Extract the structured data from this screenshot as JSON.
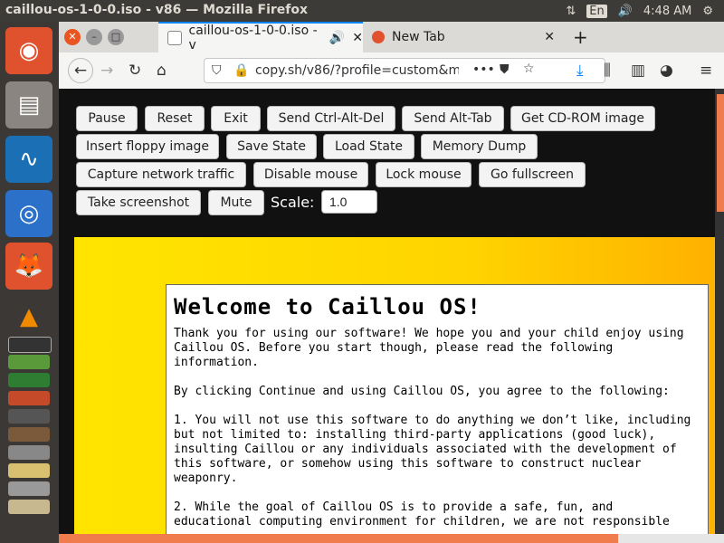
{
  "window": {
    "title": "caillou-os-1-0-0.iso - v86 — Mozilla Firefox"
  },
  "system_tray": {
    "language": "En",
    "time": "4:48 AM"
  },
  "tabs": [
    {
      "label": "caillou-os-1-0-0.iso - v",
      "active": true
    },
    {
      "label": "New Tab",
      "active": false
    }
  ],
  "url": "copy.sh/v86/?profile=custom&m=",
  "toolbar_buttons": {
    "pause": "Pause",
    "reset": "Reset",
    "exit": "Exit",
    "ctrl_alt_del": "Send Ctrl-Alt-Del",
    "alt_tab": "Send Alt-Tab",
    "cdrom": "Get CD-ROM image",
    "floppy": "Insert floppy image",
    "save_state": "Save State",
    "load_state": "Load State",
    "memory_dump": "Memory Dump",
    "capture": "Capture network traffic",
    "disable_mouse": "Disable mouse",
    "lock_mouse": "Lock mouse",
    "fullscreen": "Go fullscreen",
    "screenshot": "Take screenshot",
    "mute": "Mute"
  },
  "scale": {
    "label": "Scale:",
    "value": "1.0"
  },
  "guest": {
    "heading": "Welcome to Caillou OS!",
    "paragraphs": [
      "Thank you for using our software! We hope you and your child enjoy using\nCaillou OS. Before you start though, please read the following\ninformation.",
      "By clicking Continue and using Caillou OS, you agree to the following:",
      "1. You will not use this software to do anything we don’t like, including\nbut not limited to: installing third-party applications (good luck),\ninsulting Caillou or any individuals associated with the development of\nthis software, or somehow using this software to construct nuclear\nweaponry.",
      "2. While the goal of Caillou OS is to provide a safe, fun, and\neducational computing environment for children, we are not responsible"
    ]
  },
  "colors": {
    "accent": "#0a84ff",
    "ubuntu_orange": "#f07b4c",
    "screen_yellow": "#ffd400"
  }
}
